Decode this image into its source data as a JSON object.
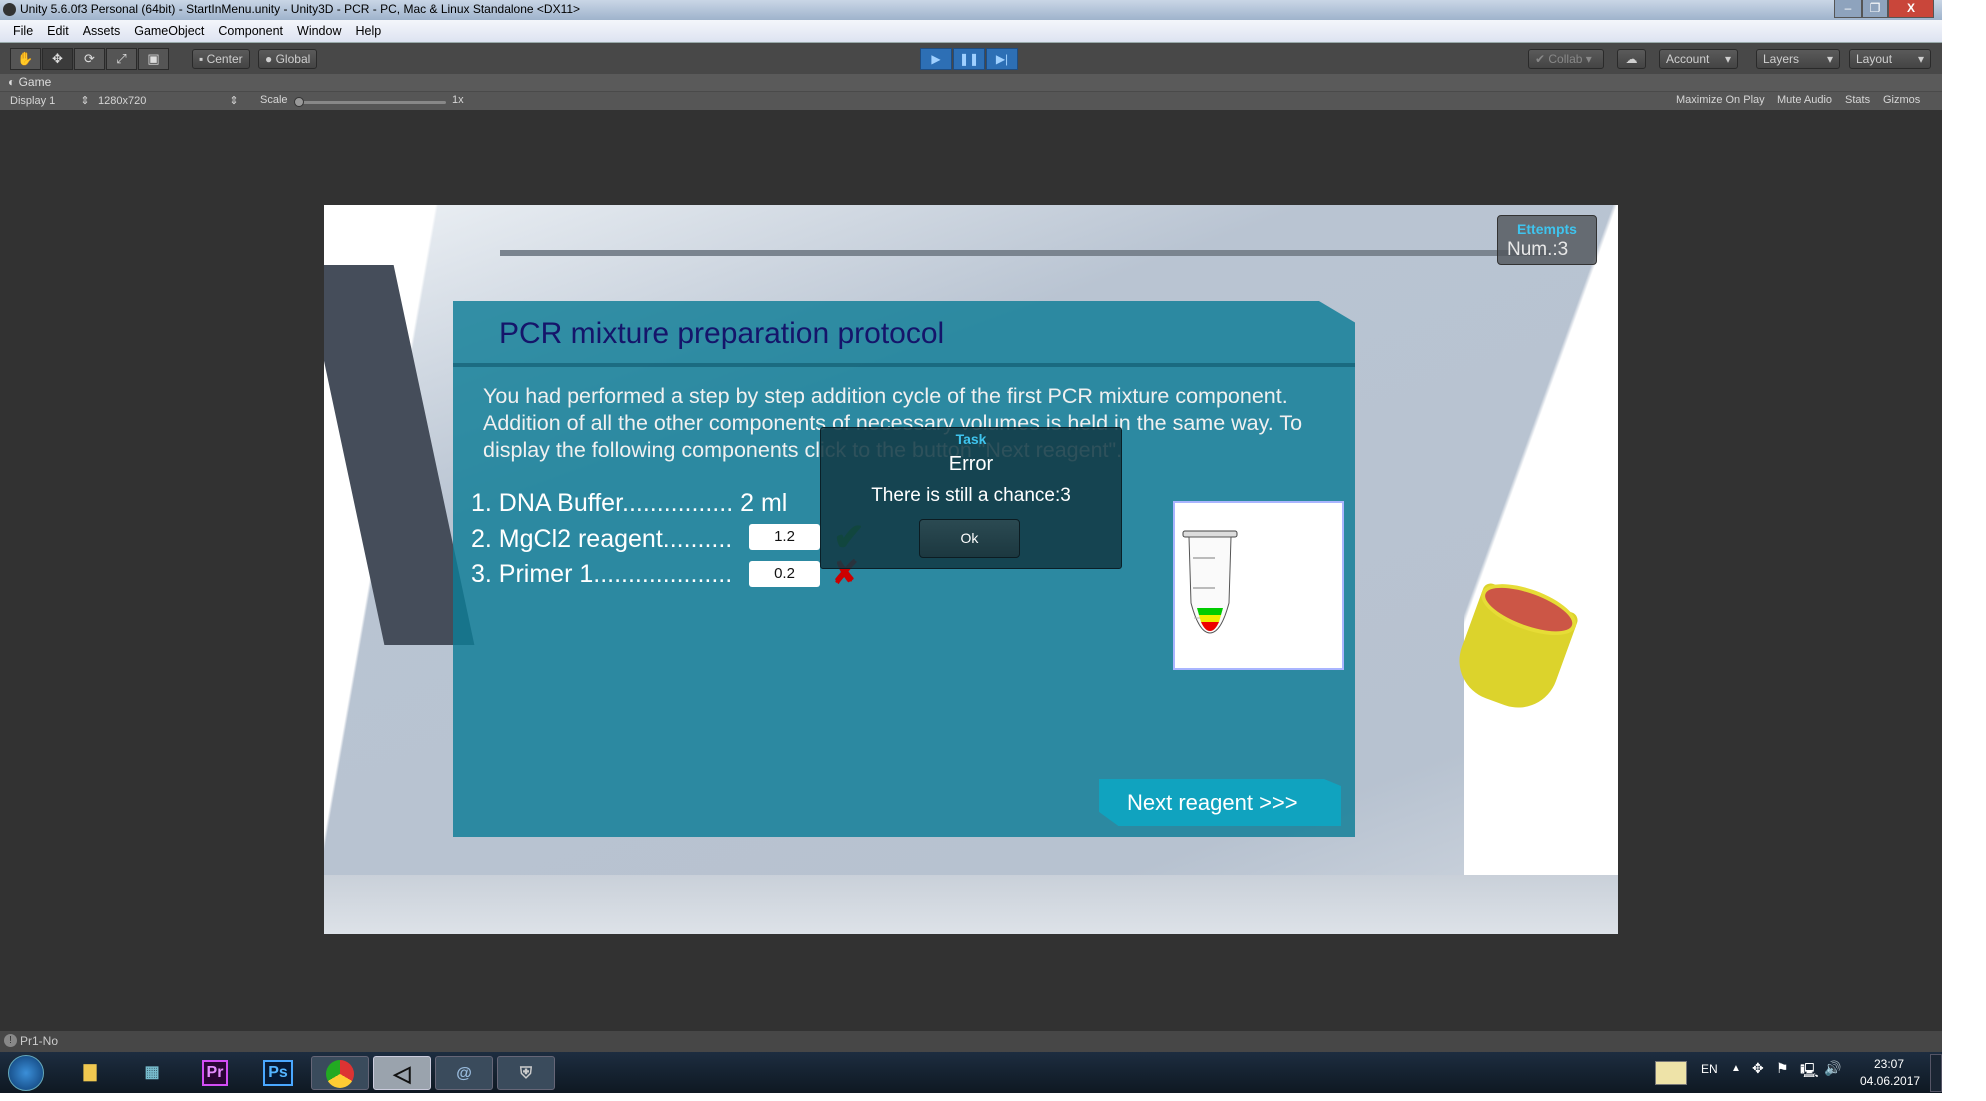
{
  "window": {
    "title": "Unity 5.6.0f3 Personal (64bit) - StartInMenu.unity - Unity3D - PCR - PC, Mac & Linux Standalone <DX11>",
    "minimize": "–",
    "restore": "❐",
    "close": "X"
  },
  "menu": [
    "File",
    "Edit",
    "Assets",
    "GameObject",
    "Component",
    "Window",
    "Help"
  ],
  "toolbar": {
    "tools": [
      "hand-tool",
      "move-tool",
      "rotate-tool",
      "scale-tool",
      "rect-tool"
    ],
    "pivot": "Center",
    "space": "Global",
    "play": "▶",
    "pause": "❚❚",
    "step": "▶|",
    "collab": "Collab",
    "account": "Account",
    "layers": "Layers",
    "layout": "Layout",
    "accent": "#2d6fb5"
  },
  "game_tab": {
    "label": "Game",
    "display": "Display 1",
    "resolution": "1280x720",
    "scale_label": "Scale",
    "scale_value": "1x",
    "maximize": "Maximize On Play",
    "mute": "Mute Audio",
    "stats": "Stats",
    "gizmos": "Gizmos"
  },
  "game": {
    "attempts": {
      "title": "Ettempts",
      "value": "Num.:3"
    },
    "panel": {
      "title": "PCR mixture preparation protocol",
      "body": "You had performed a step by step addition cycle of the first PCR mixture component. Addition of all the other components of necessary volumes is held in the same way. To display the following components click to the button \"Next reagent\".",
      "rows": [
        {
          "label": "1. DNA Buffer................ 2 ml"
        },
        {
          "label": "2. MgCl2 reagent..........",
          "value": "1.2",
          "status": "correct"
        },
        {
          "label": "3. Primer 1....................",
          "value": "0.2",
          "status": "wrong"
        }
      ],
      "next": "Next reagent   >>>"
    },
    "dialog": {
      "header": "Task",
      "title": "Error",
      "message": "There is still a chance:3",
      "ok": "Ok"
    }
  },
  "status": {
    "text": "Pr1-No"
  },
  "taskbar": {
    "apps": [
      "start",
      "explorer",
      "calculator",
      "Pr",
      "Ps",
      "chrome",
      "unity",
      "app",
      "tanks"
    ],
    "lang": "EN",
    "time": "23:07",
    "date": "04.06.2017"
  }
}
